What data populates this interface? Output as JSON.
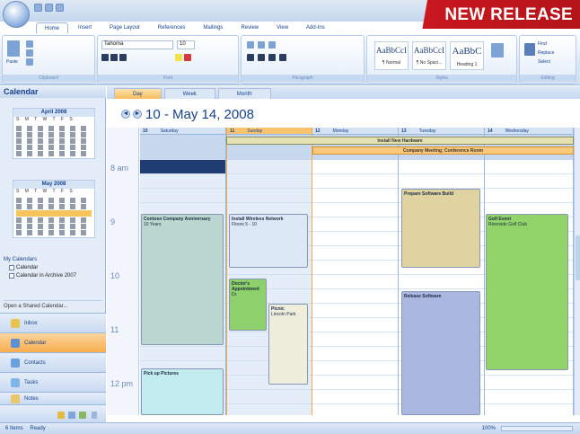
{
  "banner": {
    "text": "NEW RELEASE",
    "color": "#c9171e"
  },
  "ribbon": {
    "tabs": [
      "Home",
      "Insert",
      "Page Layout",
      "References",
      "Mailings",
      "Review",
      "View",
      "Add-Ins"
    ],
    "active_tab": "Home",
    "groups": [
      "Clipboard",
      "Font",
      "Paragraph",
      "Styles",
      "Editing"
    ],
    "paste_label": "Paste",
    "font_name": "Tahoma",
    "font_size": "10",
    "styles": [
      {
        "sample": "AaBbCcI",
        "name": "¶ Normal"
      },
      {
        "sample": "AaBbCcI",
        "name": "¶ No Spaci..."
      },
      {
        "sample": "AaBbC",
        "name": "Heading 1"
      }
    ],
    "editing": [
      "Find",
      "Replace",
      "Select"
    ]
  },
  "nav": {
    "title": "Calendar",
    "month1": "April 2008",
    "month2": "May 2008",
    "weekdays": "S M T W T F S",
    "my_calendars_label": "My Calendars",
    "calendars": [
      "Calendar",
      "Calendar in Archive 2007"
    ],
    "open_shared": "Open a Shared Calendar...",
    "buttons": [
      "Inbox",
      "Calendar",
      "Contacts",
      "Tasks",
      "Notes"
    ]
  },
  "calendar": {
    "views": [
      "Day",
      "Week",
      "Month"
    ],
    "active_view": "Day",
    "date_range": "10 - May 14, 2008",
    "nav_back": "◄",
    "nav_forward": "►",
    "days": [
      {
        "num": "10",
        "name": "Saturday"
      },
      {
        "num": "11",
        "name": "Sunday"
      },
      {
        "num": "12",
        "name": "Monday"
      },
      {
        "num": "13",
        "name": "Tuesday"
      },
      {
        "num": "14",
        "name": "Wednesday"
      }
    ],
    "times": [
      "8 am",
      "9",
      "10",
      "11",
      "12 pm"
    ],
    "banners": [
      {
        "label": "Install New Hardware"
      },
      {
        "label": "Company Meeting; Conference Room"
      }
    ],
    "events": [
      {
        "title": "Contoso Company Anniversary",
        "sub": "10 Years",
        "color": "#b9d7cf"
      },
      {
        "title": "Install Wireless Network",
        "sub": "Floors 5 - 10",
        "color": "#dde8f6"
      },
      {
        "title": "Doctor's Appointment",
        "sub": "Dr.",
        "color": "#8dd06c"
      },
      {
        "title": "Picnic",
        "sub": "Lincoln Park",
        "color": "#efeedd"
      },
      {
        "title": "Pick up Pictures",
        "sub": "",
        "color": "#c2ecef"
      },
      {
        "title": "Prepare Software Build",
        "sub": "",
        "color": "#e0d3a2"
      },
      {
        "title": "Release Software",
        "sub": "",
        "color": "#aab7e0"
      },
      {
        "title": "Golf Event",
        "sub": "Riverside Golf Club",
        "color": "#93d46a"
      }
    ]
  },
  "status": {
    "items": "6 Items",
    "state": "Ready",
    "zoom": "100%"
  }
}
